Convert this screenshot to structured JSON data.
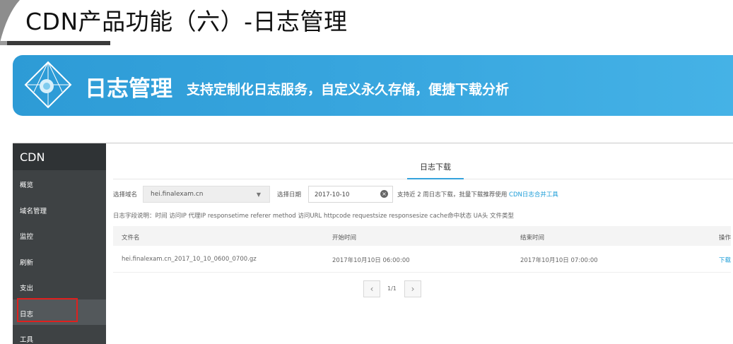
{
  "slide": {
    "title": "CDN产品功能（六）-日志管理",
    "banner_title": "日志管理",
    "banner_subtitle": "支持定制化日志服务，自定义永久存储，便捷下载分析"
  },
  "sidebar": {
    "brand": "CDN",
    "items": [
      {
        "label": "概览"
      },
      {
        "label": "域名管理"
      },
      {
        "label": "监控"
      },
      {
        "label": "刷新"
      },
      {
        "label": "支出"
      },
      {
        "label": "日志"
      },
      {
        "label": "工具"
      }
    ],
    "active_index": 5
  },
  "main": {
    "tab_label": "日志下载",
    "filter": {
      "domain_label": "选择域名",
      "domain_value": "hei.finalexam.cn",
      "date_label": "选择日期",
      "date_value": "2017-10-10",
      "note": "支持近 2 周日志下载，批量下载推荐使用 ",
      "note_link": "CDN日志合并工具"
    },
    "fields_desc": "日志字段说明：时间 访问IP 代理IP responsetime referer method 访问URL httpcode requestsize responsesize cache命中状态 UA头 文件类型",
    "table": {
      "headers": [
        "文件名",
        "开始时间",
        "结束时间",
        "操作"
      ],
      "rows": [
        {
          "file": "hei.finalexam.cn_2017_10_10_0600_0700.gz",
          "start": "2017年10月10日 06:00:00",
          "end": "2017年10月10日 07:00:00",
          "action": "下载"
        }
      ]
    },
    "pager": {
      "text": "1/1"
    }
  },
  "colors": {
    "accent": "#1a9cd7",
    "sidebar_bg": "#3e4244",
    "banner": "#3aa8e0",
    "highlight": "#e0201e"
  }
}
